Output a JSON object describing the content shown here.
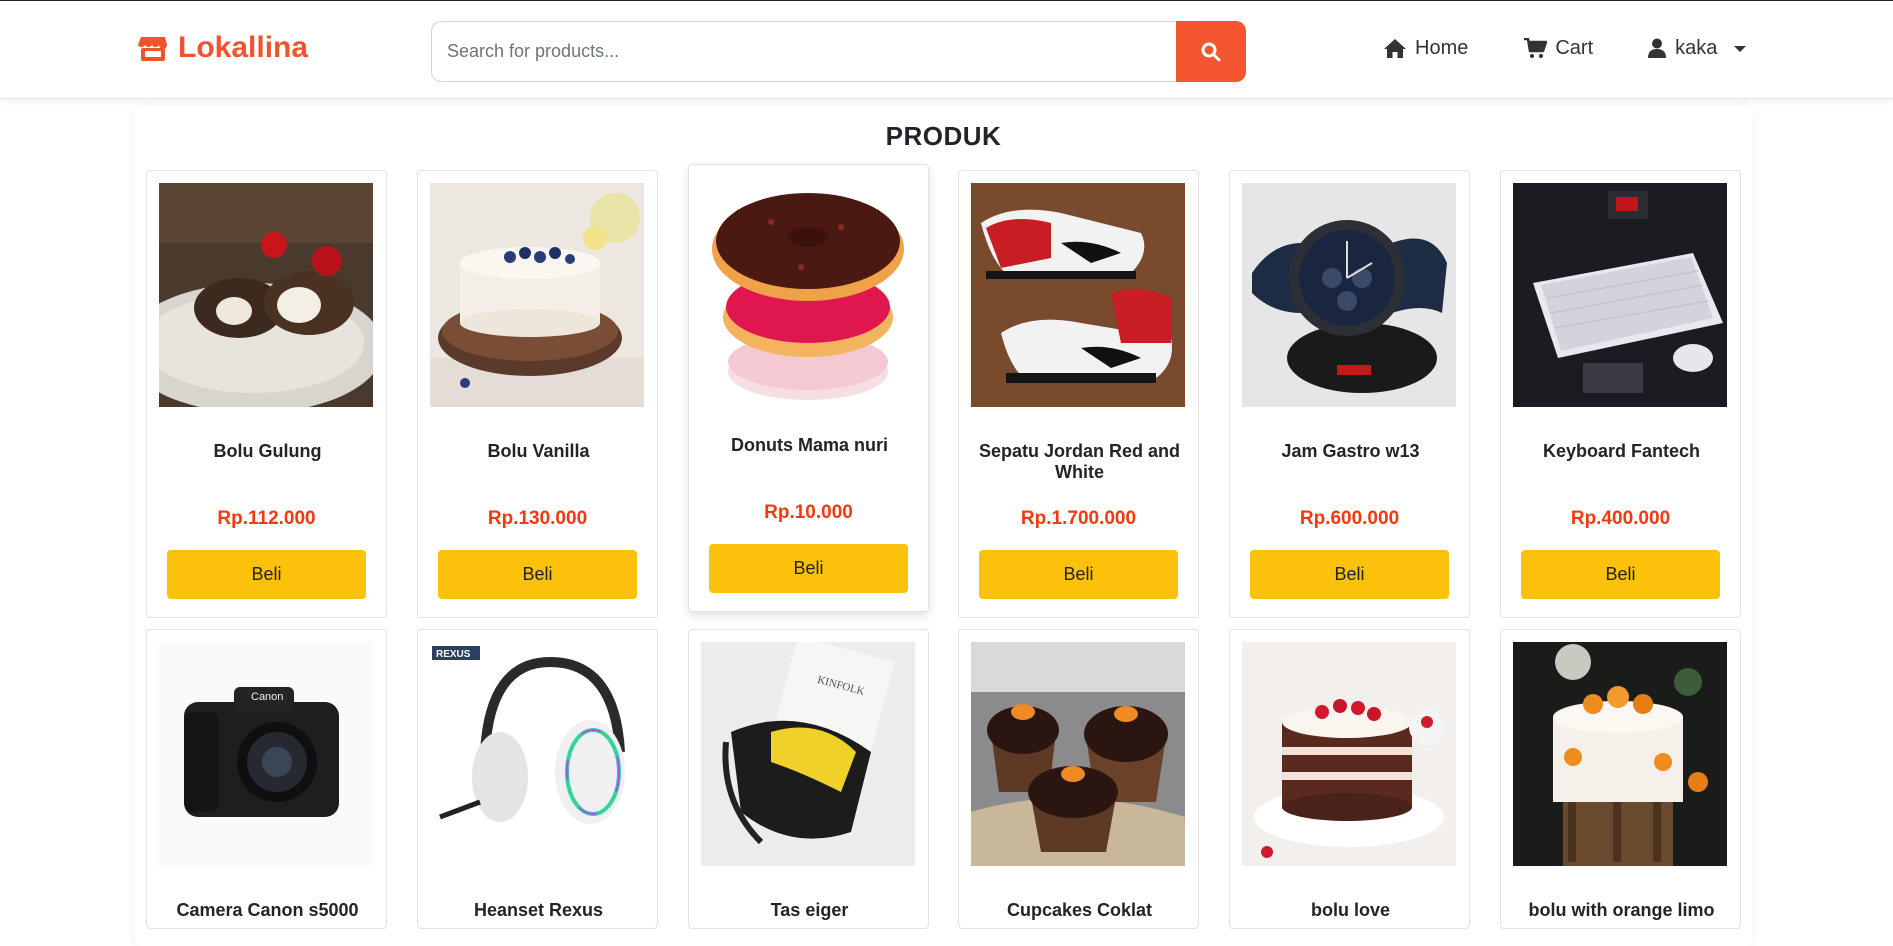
{
  "brand": {
    "name": "Lokallina",
    "color": "#f0542d"
  },
  "search": {
    "placeholder": "Search for products...",
    "button_color": "#f5562f"
  },
  "nav": {
    "home": "Home",
    "cart": "Cart",
    "user": "kaka"
  },
  "section_title": "PRODUK",
  "colors": {
    "price": "#f23a0e",
    "buy_button": "#fcc20b"
  },
  "products": [
    {
      "name": "Bolu Gulung",
      "price": "Rp.112.000",
      "buy": "Beli"
    },
    {
      "name": "Bolu Vanilla",
      "price": "Rp.130.000",
      "buy": "Beli"
    },
    {
      "name": "Donuts Mama nuri",
      "price": "Rp.10.000",
      "buy": "Beli"
    },
    {
      "name": "Sepatu Jordan Red and White",
      "price": "Rp.1.700.000",
      "buy": "Beli"
    },
    {
      "name": "Jam Gastro w13",
      "price": "Rp.600.000",
      "buy": "Beli"
    },
    {
      "name": "Keyboard Fantech",
      "price": "Rp.400.000",
      "buy": "Beli"
    },
    {
      "name": "Camera Canon s5000"
    },
    {
      "name": "Heanset Rexus"
    },
    {
      "name": "Tas eiger"
    },
    {
      "name": "Cupcakes Coklat"
    },
    {
      "name": "bolu love"
    },
    {
      "name": "bolu with orange limo"
    }
  ]
}
